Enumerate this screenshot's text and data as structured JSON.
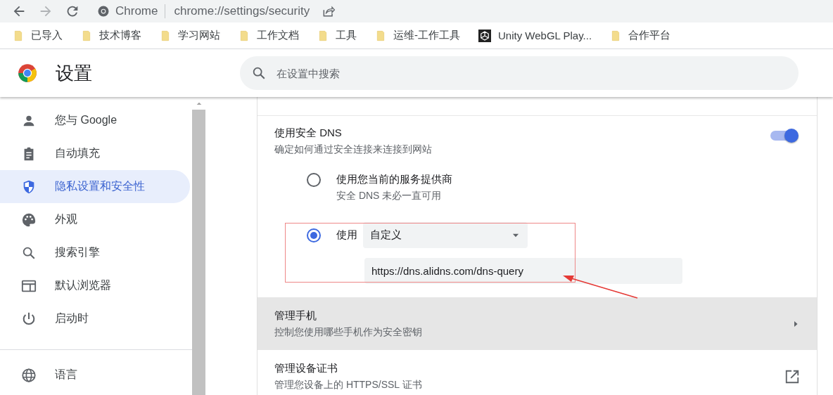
{
  "toolbar": {
    "site_label": "Chrome",
    "url": "chrome://settings/security"
  },
  "bookmarks": [
    {
      "kind": "folder",
      "label": "已导入"
    },
    {
      "kind": "folder",
      "label": "技术博客"
    },
    {
      "kind": "folder",
      "label": "学习网站"
    },
    {
      "kind": "folder",
      "label": "工作文档"
    },
    {
      "kind": "folder",
      "label": "工具"
    },
    {
      "kind": "folder",
      "label": "运维-工作工具"
    },
    {
      "kind": "site",
      "label": "Unity WebGL Play..."
    },
    {
      "kind": "folder",
      "label": "合作平台"
    }
  ],
  "header": {
    "title": "设置",
    "search": {
      "placeholder": "在设置中搜索"
    }
  },
  "sidebar": {
    "groups": [
      [
        {
          "label": "您与 Google",
          "selected": false
        },
        {
          "label": "自动填充",
          "selected": false
        },
        {
          "label": "隐私设置和安全性",
          "selected": true
        },
        {
          "label": "外观",
          "selected": false
        },
        {
          "label": "搜索引擎",
          "selected": false
        },
        {
          "label": "默认浏览器",
          "selected": false
        },
        {
          "label": "启动时",
          "selected": false
        }
      ],
      [
        {
          "label": "语言",
          "selected": false
        }
      ]
    ]
  },
  "dns": {
    "title": "使用安全 DNS",
    "description": "确定如何通过安全连接来连接到网站",
    "on": true,
    "options": [
      {
        "kind": "plain",
        "label": "使用您当前的服务提供商",
        "description": "安全 DNS 未必一直可用",
        "selected": false
      },
      {
        "kind": "custom",
        "label": "使用",
        "provider": "自定义",
        "url": "https://dns.alidns.com/dns-query",
        "selected": true
      }
    ]
  },
  "rows": [
    {
      "title": "管理手机",
      "description": "控制您使用哪些手机作为安全密钥",
      "highlighted": true,
      "kind": "submenu"
    },
    {
      "title": "管理设备证书",
      "description": "管理您设备上的 HTTPS/SSL 证书",
      "highlighted": false,
      "kind": "external"
    }
  ]
}
